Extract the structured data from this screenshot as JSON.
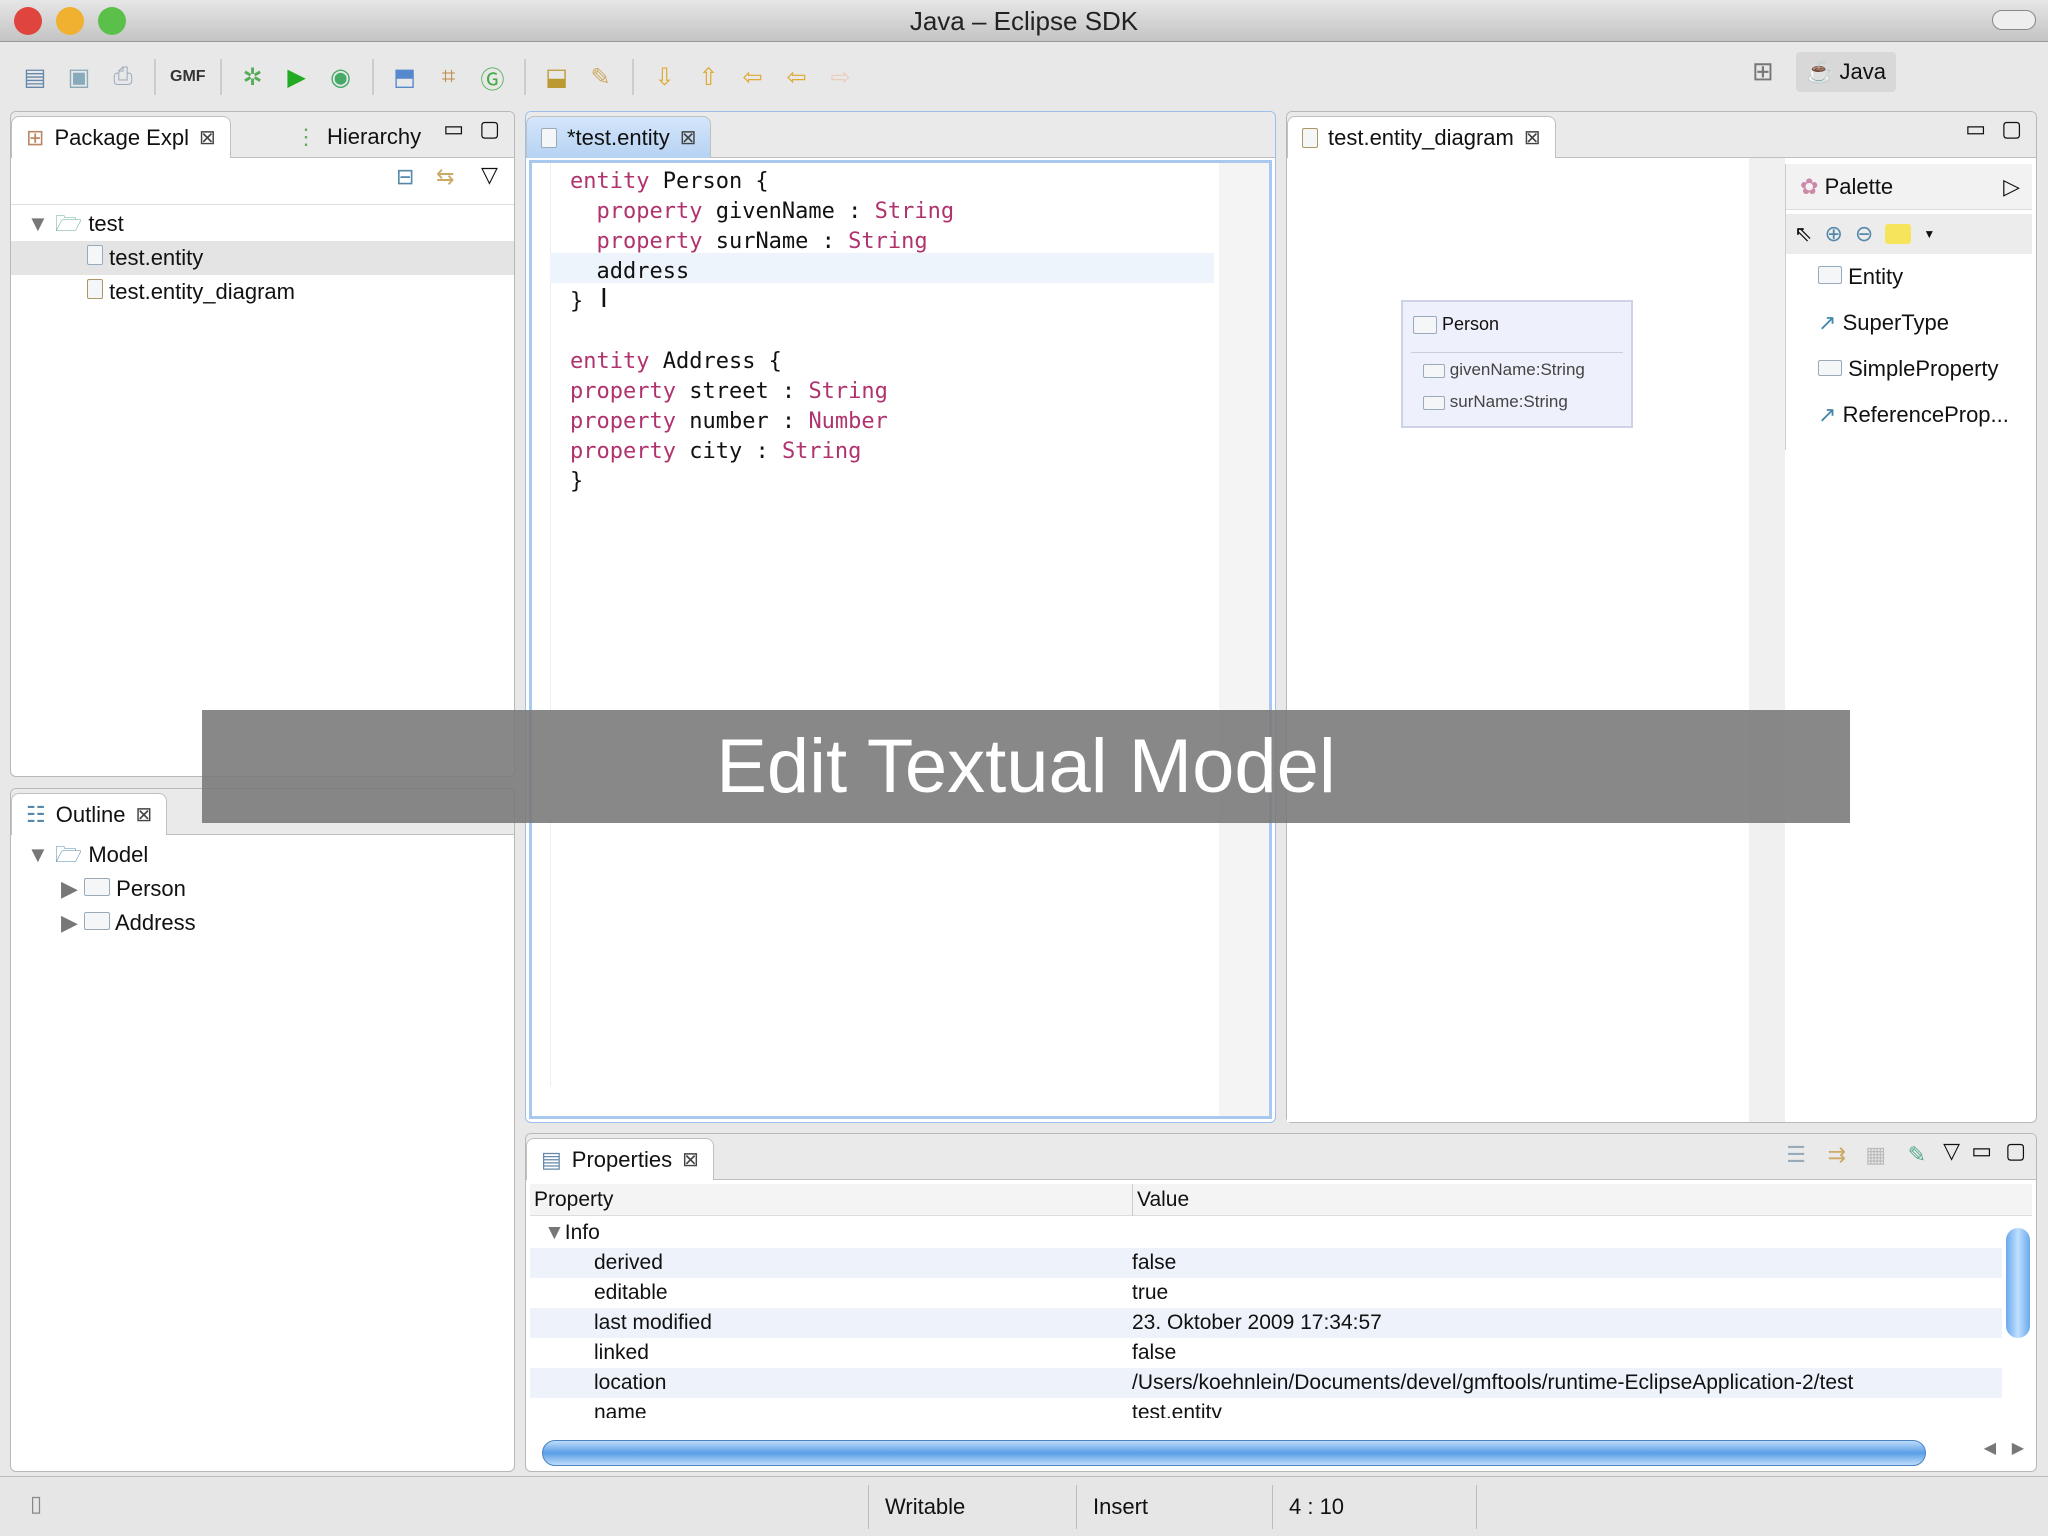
{
  "window": {
    "title": "Java – Eclipse SDK"
  },
  "toolbar": {
    "gmf_label": "GMF",
    "perspective": "Java"
  },
  "left": {
    "tabs": [
      "Package Expl",
      "Hierarchy"
    ],
    "tree": {
      "project": "test",
      "files": [
        "test.entity",
        "test.entity_diagram"
      ]
    }
  },
  "outline": {
    "tab": "Outline",
    "root": "Model",
    "children": [
      "Person",
      "Address"
    ]
  },
  "editor": {
    "tab": "*test.entity",
    "lines": [
      [
        [
          "entity ",
          "kw"
        ],
        [
          "Person {",
          ""
        ]
      ],
      [
        [
          "  property ",
          "kw"
        ],
        [
          "givenName : ",
          ""
        ],
        [
          "String",
          "kw"
        ]
      ],
      [
        [
          "  property ",
          "kw"
        ],
        [
          "surName : ",
          ""
        ],
        [
          "String",
          "kw"
        ]
      ],
      [
        [
          "  address",
          ""
        ]
      ],
      [
        [
          "}",
          ""
        ]
      ],
      [
        [
          "",
          ""
        ]
      ],
      [
        [
          "entity ",
          "kw"
        ],
        [
          "Address {",
          ""
        ]
      ],
      [
        [
          "property ",
          "kw"
        ],
        [
          "street : ",
          ""
        ],
        [
          "String",
          "kw"
        ]
      ],
      [
        [
          "property ",
          "kw"
        ],
        [
          "number : ",
          ""
        ],
        [
          "Number",
          "kw"
        ]
      ],
      [
        [
          "property ",
          "kw"
        ],
        [
          "city : ",
          ""
        ],
        [
          "String",
          "kw"
        ]
      ],
      [
        [
          "}",
          ""
        ]
      ]
    ]
  },
  "diagram": {
    "tab": "test.entity_diagram",
    "node": {
      "name": "Person",
      "props": [
        "givenName:String",
        "surName:String"
      ]
    },
    "palette": {
      "title": "Palette",
      "items": [
        "Entity",
        "SuperType",
        "SimpleProperty",
        "ReferenceProp..."
      ]
    }
  },
  "properties": {
    "tab": "Properties",
    "headers": [
      "Property",
      "Value"
    ],
    "group": "Info",
    "rows": [
      [
        "derived",
        "false"
      ],
      [
        "editable",
        "true"
      ],
      [
        "last modified",
        "23. Oktober 2009 17:34:57"
      ],
      [
        "linked",
        "false"
      ],
      [
        "location",
        "/Users/koehnlein/Documents/devel/gmftools/runtime-EclipseApplication-2/test"
      ],
      [
        "name",
        "test.entity"
      ]
    ]
  },
  "overlay": {
    "caption": "Edit Textual Model"
  },
  "status": {
    "writable": "Writable",
    "mode": "Insert",
    "position": "4 : 10"
  }
}
